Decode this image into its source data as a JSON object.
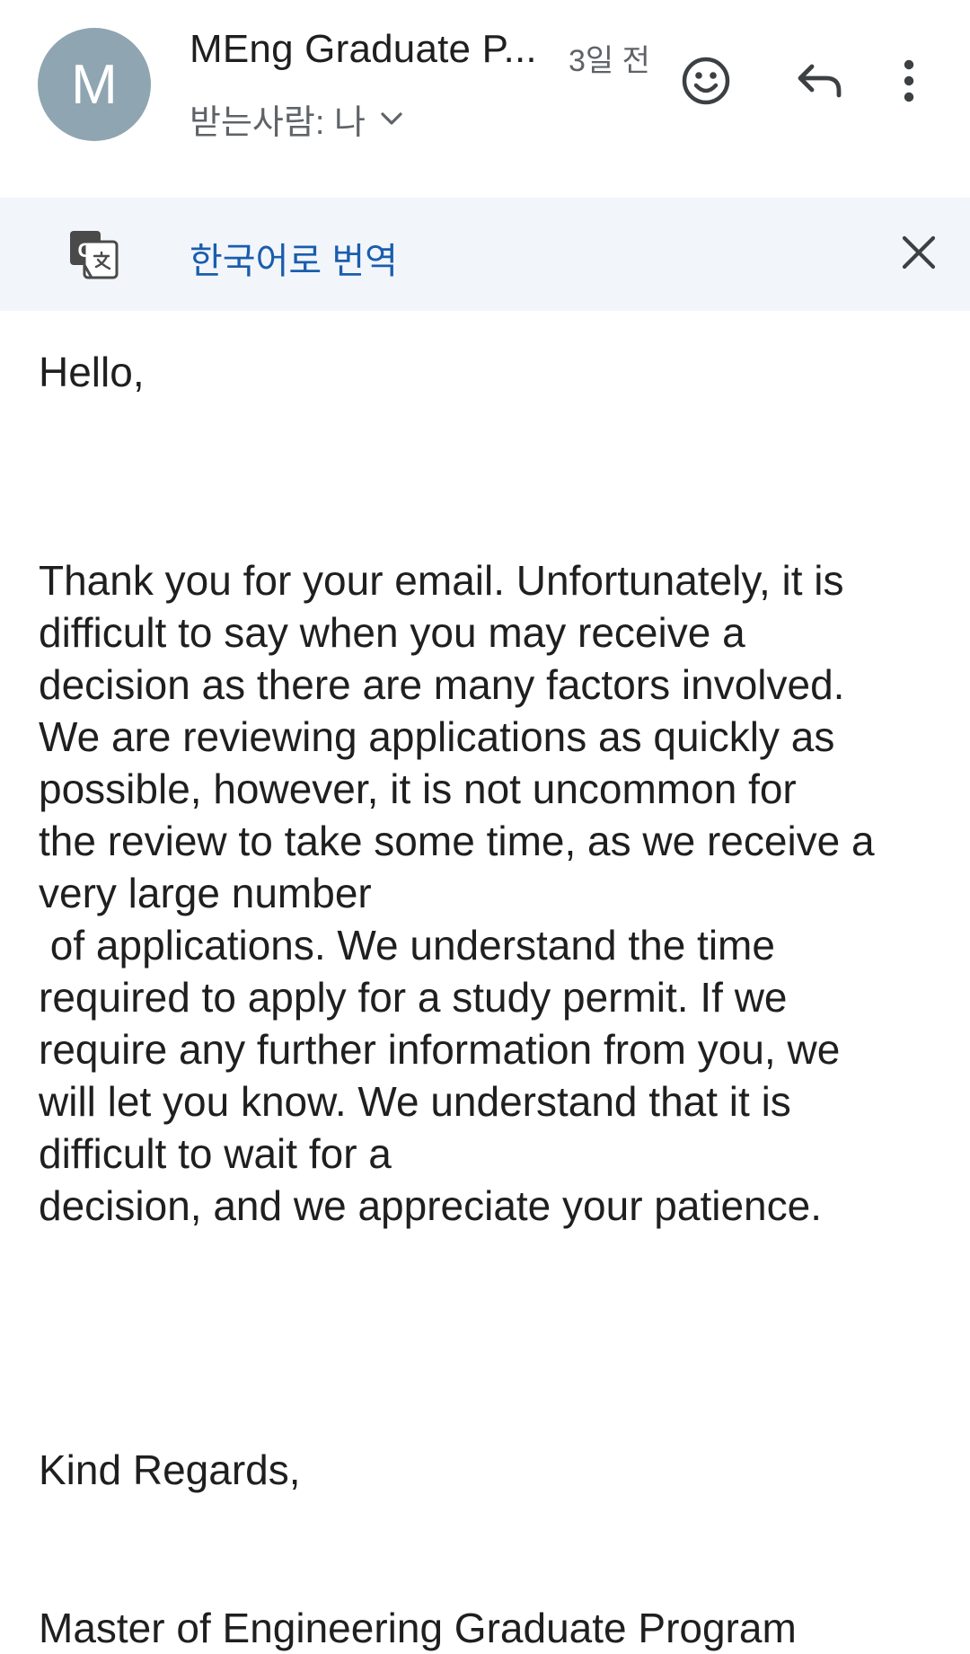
{
  "header": {
    "avatar_letter": "M",
    "sender_name": "MEng Graduate P...",
    "sent_time": "3일 전",
    "recipient": "받는사람: 나",
    "icons": {
      "emoji": "smiley-face-icon",
      "reply": "reply-arrow-icon",
      "more": "more-vertical-icon",
      "expand": "chevron-down-icon"
    }
  },
  "translate_bar": {
    "icon": "google-translate-icon",
    "link_label": "한국어로 번역",
    "close_icon": "close-icon"
  },
  "email": {
    "greeting": "Hello,",
    "body_lines": [
      "Thank you for your email. Unfortunately, it is",
      "difficult to say when you may receive a",
      "decision as there are many factors involved.",
      "We are reviewing applications as quickly as",
      "possible, however, it is not uncommon for",
      "the review to take some time, as we receive a",
      "very large number",
      " of applications. We understand the time",
      "required to apply for a study permit. If we",
      "require any further information from you, we",
      "will let you know. We understand that it is",
      "difficult to wait for a",
      "decision, and we appreciate your patience."
    ],
    "closing": "Kind Regards,",
    "signature": "Master of Engineering Graduate Program"
  },
  "colors": {
    "avatar_bg": "#8fa5b1",
    "translate_bar_bg": "#f2f6fb",
    "link": "#1a5dad",
    "secondary_text": "#5f6368",
    "primary_text": "#1f1f1f"
  }
}
